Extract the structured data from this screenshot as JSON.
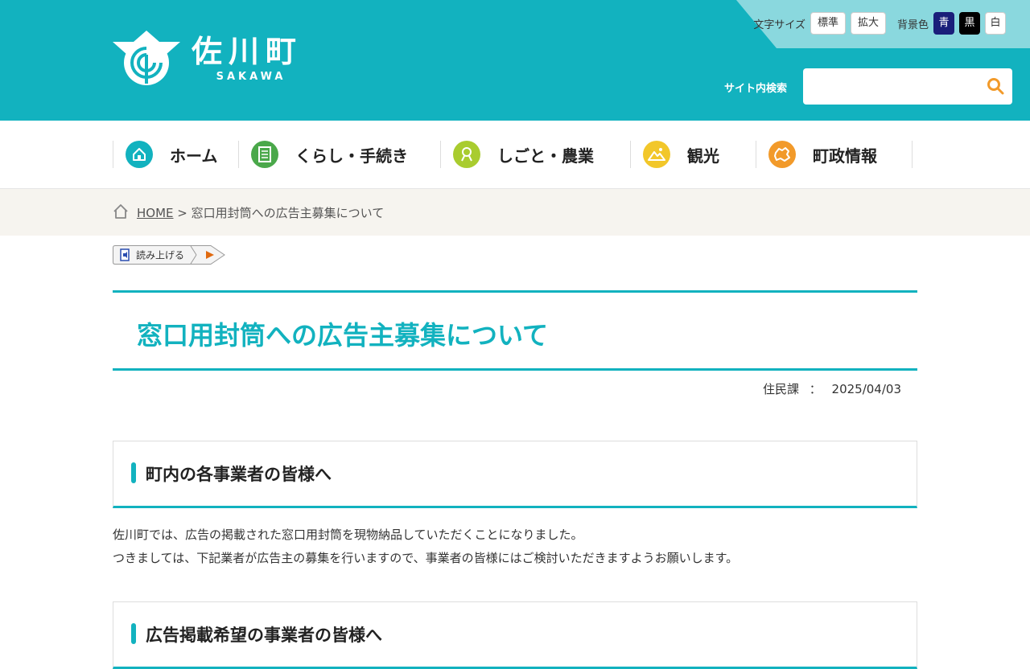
{
  "header": {
    "logo_jp": "佐川町",
    "logo_en": "SAKAWA",
    "font_size_label": "文字サイズ",
    "font_standard": "標準",
    "font_large": "拡大",
    "bg_color_label": "背景色",
    "bg_blue": "青",
    "bg_black": "黒",
    "bg_white": "白",
    "search_label": "サイト内検索",
    "search_value": "",
    "search_icon": "search-icon"
  },
  "nav": {
    "items": [
      {
        "label": "ホーム",
        "icon": "home-icon",
        "color": "#12b2bf"
      },
      {
        "label": "くらし・手続き",
        "icon": "document-icon",
        "color": "#4aa84a"
      },
      {
        "label": "しごと・農業",
        "icon": "person-icon",
        "color": "#a9cc2f"
      },
      {
        "label": "観光",
        "icon": "mountain-icon",
        "color": "#f2c72a"
      },
      {
        "label": "町政情報",
        "icon": "town-map-icon",
        "color": "#f29a2a"
      }
    ]
  },
  "breadcrumb": {
    "home": "HOME",
    "separator": ">",
    "current": "窓口用封筒への広告主募集について"
  },
  "readaloud": {
    "label": "読み上げる"
  },
  "page": {
    "title": "窓口用封筒への広告主募集について",
    "department": "住民課",
    "meta_sep": "：",
    "date": "2025/04/03"
  },
  "sections": [
    {
      "heading": "町内の各事業者の皆様へ"
    },
    {
      "heading": "広告掲載希望の事業者の皆様へ"
    }
  ],
  "body": {
    "line1": "佐川町では、広告の掲載された窓口用封筒を現物納品していただくことになりました。",
    "line2": "つきましては、下記業者が広告主の募集を行いますので、事業者の皆様にはご検討いただきますようお願いします。"
  },
  "colors": {
    "brand": "#12b2bf",
    "brand_light": "#8ad8de",
    "breadcrumb_bg": "#f6f4ef",
    "search_icon": "#f29a2a"
  }
}
